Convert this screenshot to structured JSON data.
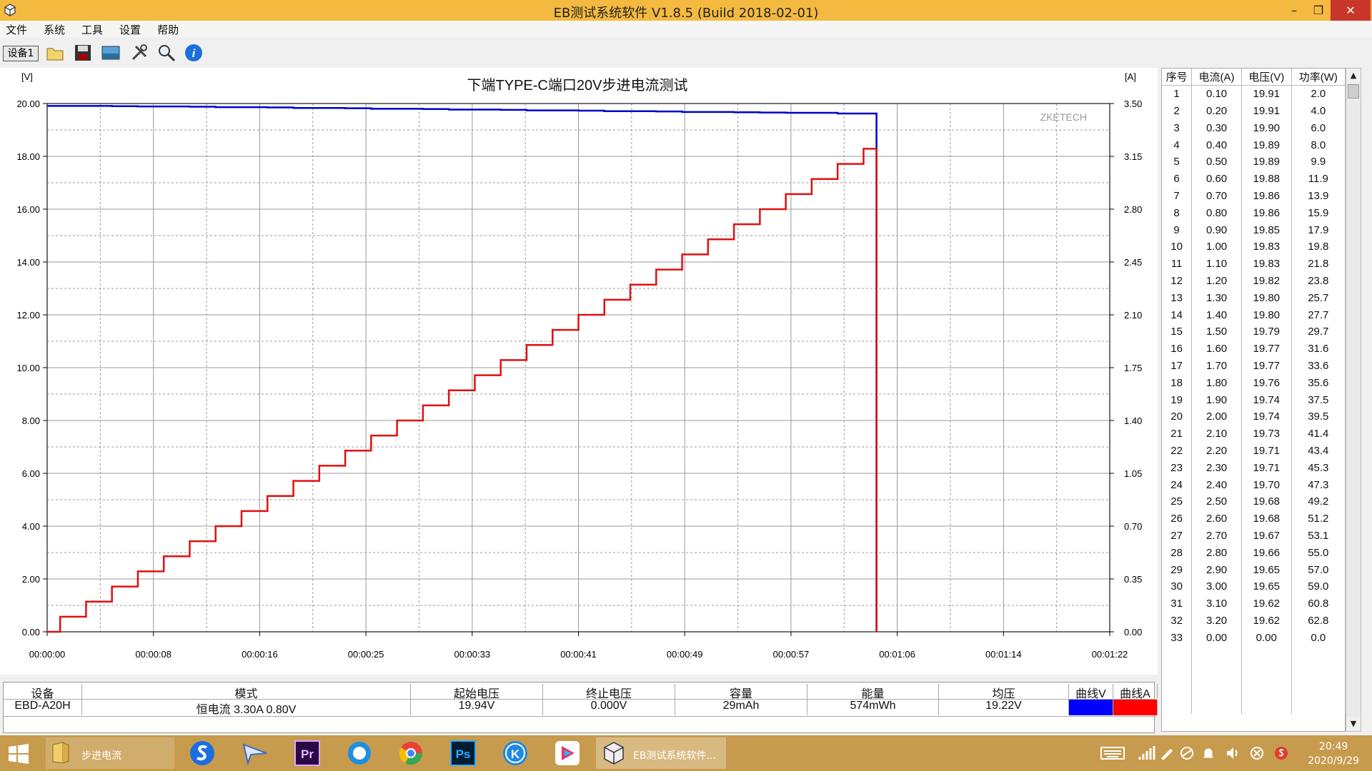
{
  "window": {
    "title": "EB测试系统软件 V1.8.5 (Build 2018-02-01)"
  },
  "menu": [
    "文件",
    "系统",
    "工具",
    "设置",
    "帮助"
  ],
  "toolbar": {
    "device_button": "设备1"
  },
  "chart_data": {
    "type": "line",
    "title": "下端TYPE-C端口20V步进电流测试",
    "watermark": "ZKETECH",
    "left_unit": "[V]",
    "right_unit": "[A]",
    "left_ticks": [
      "0.00",
      "2.00",
      "4.00",
      "6.00",
      "8.00",
      "10.00",
      "12.00",
      "14.00",
      "16.00",
      "18.00",
      "20.00"
    ],
    "right_ticks": [
      "0.00",
      "0.35",
      "0.70",
      "1.05",
      "1.40",
      "1.75",
      "2.10",
      "2.45",
      "2.80",
      "3.15",
      "3.50"
    ],
    "x_ticks": [
      "00:00:00",
      "00:00:08",
      "00:00:16",
      "00:00:25",
      "00:00:33",
      "00:00:41",
      "00:00:49",
      "00:00:57",
      "00:01:06",
      "00:01:14",
      "00:01:22"
    ],
    "ylim_left": [
      0,
      20
    ],
    "ylim_right": [
      0,
      3.5
    ],
    "xlim_seconds": [
      0,
      82
    ],
    "step_seconds": 2,
    "step_start_seconds": 1,
    "end_seconds": 64,
    "grid": true,
    "series": [
      {
        "color": "#0000cc",
        "axis": "left",
        "values": [
          19.91,
          19.91,
          19.9,
          19.89,
          19.89,
          19.88,
          19.86,
          19.86,
          19.85,
          19.83,
          19.83,
          19.82,
          19.8,
          19.8,
          19.79,
          19.77,
          19.77,
          19.76,
          19.74,
          19.74,
          19.73,
          19.71,
          19.71,
          19.7,
          19.68,
          19.68,
          19.67,
          19.66,
          19.65,
          19.65,
          19.62,
          19.62
        ]
      },
      {
        "color": "#e01010",
        "axis": "right",
        "values": [
          0.1,
          0.2,
          0.3,
          0.4,
          0.5,
          0.6,
          0.7,
          0.8,
          0.9,
          1.0,
          1.1,
          1.2,
          1.3,
          1.4,
          1.5,
          1.6,
          1.7,
          1.8,
          1.9,
          2.0,
          2.1,
          2.2,
          2.3,
          2.4,
          2.5,
          2.6,
          2.7,
          2.8,
          2.9,
          3.0,
          3.1,
          3.2
        ]
      }
    ]
  },
  "table": {
    "headers": [
      "序号",
      "电流(A)",
      "电压(V)",
      "功率(W)"
    ],
    "rows": [
      [
        "1",
        "0.10",
        "19.91",
        "2.0"
      ],
      [
        "2",
        "0.20",
        "19.91",
        "4.0"
      ],
      [
        "3",
        "0.30",
        "19.90",
        "6.0"
      ],
      [
        "4",
        "0.40",
        "19.89",
        "8.0"
      ],
      [
        "5",
        "0.50",
        "19.89",
        "9.9"
      ],
      [
        "6",
        "0.60",
        "19.88",
        "11.9"
      ],
      [
        "7",
        "0.70",
        "19.86",
        "13.9"
      ],
      [
        "8",
        "0.80",
        "19.86",
        "15.9"
      ],
      [
        "9",
        "0.90",
        "19.85",
        "17.9"
      ],
      [
        "10",
        "1.00",
        "19.83",
        "19.8"
      ],
      [
        "11",
        "1.10",
        "19.83",
        "21.8"
      ],
      [
        "12",
        "1.20",
        "19.82",
        "23.8"
      ],
      [
        "13",
        "1.30",
        "19.80",
        "25.7"
      ],
      [
        "14",
        "1.40",
        "19.80",
        "27.7"
      ],
      [
        "15",
        "1.50",
        "19.79",
        "29.7"
      ],
      [
        "16",
        "1.60",
        "19.77",
        "31.6"
      ],
      [
        "17",
        "1.70",
        "19.77",
        "33.6"
      ],
      [
        "18",
        "1.80",
        "19.76",
        "35.6"
      ],
      [
        "19",
        "1.90",
        "19.74",
        "37.5"
      ],
      [
        "20",
        "2.00",
        "19.74",
        "39.5"
      ],
      [
        "21",
        "2.10",
        "19.73",
        "41.4"
      ],
      [
        "22",
        "2.20",
        "19.71",
        "43.4"
      ],
      [
        "23",
        "2.30",
        "19.71",
        "45.3"
      ],
      [
        "24",
        "2.40",
        "19.70",
        "47.3"
      ],
      [
        "25",
        "2.50",
        "19.68",
        "49.2"
      ],
      [
        "26",
        "2.60",
        "19.68",
        "51.2"
      ],
      [
        "27",
        "2.70",
        "19.67",
        "53.1"
      ],
      [
        "28",
        "2.80",
        "19.66",
        "55.0"
      ],
      [
        "29",
        "2.90",
        "19.65",
        "57.0"
      ],
      [
        "30",
        "3.00",
        "19.65",
        "59.0"
      ],
      [
        "31",
        "3.10",
        "19.62",
        "60.8"
      ],
      [
        "32",
        "3.20",
        "19.62",
        "62.8"
      ],
      [
        "33",
        "0.00",
        "0.00",
        "0.0"
      ]
    ]
  },
  "info": {
    "headers": [
      "设备",
      "模式",
      "起始电压",
      "终止电压",
      "容量",
      "能量",
      "均压",
      "曲线V",
      "曲线A"
    ],
    "device": "EBD-A20H",
    "mode": "恒电流  3.30A  0.80V",
    "start_v": "19.94V",
    "end_v": "0.000V",
    "capacity": "29mAh",
    "energy": "574mWh",
    "avg_v": "19.22V",
    "curve_v_color": "#0000ff",
    "curve_a_color": "#ff0000"
  },
  "taskbar": {
    "folder_label": "步进电流",
    "active_label": "EB测试系统软件...",
    "time": "20:49",
    "date": "2020/9/29"
  }
}
